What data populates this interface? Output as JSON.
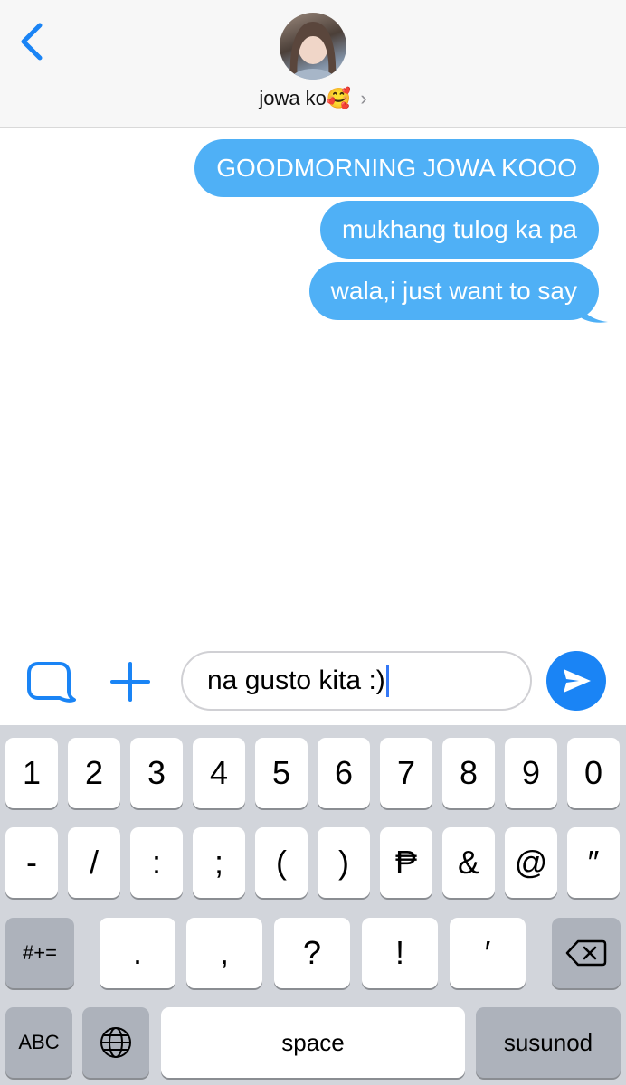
{
  "header": {
    "contact_name": "jowa ko🥰",
    "chevron": "›",
    "back_icon": "chevron-left-icon"
  },
  "messages": [
    "GOODMORNING JOWA KOOO",
    "mukhang tulog ka pa",
    "wala,i just want to say"
  ],
  "composer": {
    "text": "na gusto kita :)",
    "app_icon": "app-store-icon",
    "plus_icon": "plus-icon",
    "send_icon": "send-arrow-icon"
  },
  "keyboard": {
    "row1": [
      "1",
      "2",
      "3",
      "4",
      "5",
      "6",
      "7",
      "8",
      "9",
      "0"
    ],
    "row2": [
      "-",
      "/",
      ":",
      ";",
      "(",
      ")",
      "₱",
      "&",
      "@",
      "″"
    ],
    "row3_mode": "#+=",
    "row3": [
      ".",
      ",",
      "?",
      "!",
      "′"
    ],
    "row4": {
      "abc": "ABC",
      "space": "space",
      "return": "susunod"
    }
  },
  "colors": {
    "bubble": "#4fb0f6",
    "accent": "#1a84f5",
    "keyboard_bg": "#d2d5db"
  }
}
